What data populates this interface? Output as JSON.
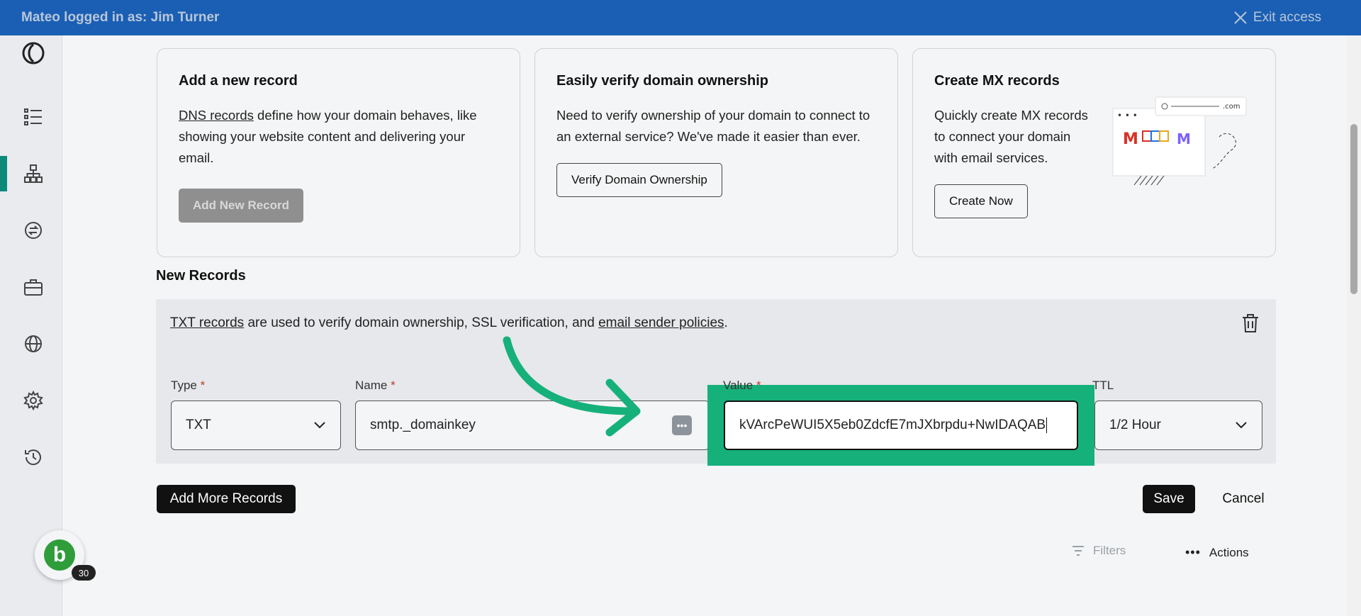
{
  "topbar": {
    "logged_in_text": "Mateo logged in as: Jim Turner",
    "exit_label": "Exit access"
  },
  "sidebar": {
    "icons": [
      "logo-icon",
      "list-icon",
      "sitemap-icon",
      "transfer-icon",
      "briefcase-icon",
      "globe-icon",
      "gear-icon",
      "history-icon"
    ],
    "avatar_letter": "b",
    "avatar_badge": "30"
  },
  "cards": [
    {
      "title": "Add a new record",
      "link_text": "DNS records",
      "body": " define how your domain behaves, like showing your website content and delivering your email.",
      "button": "Add New Record"
    },
    {
      "title": "Easily verify domain ownership",
      "body": "Need to verify ownership of your domain to connect to an external service? We've made it easier than ever.",
      "button": "Verify Domain Ownership"
    },
    {
      "title": "Create MX records",
      "body": "Quickly create MX records to connect your domain with email services.",
      "button": "Create Now",
      "illustration_text": ".com"
    }
  ],
  "new_records": {
    "title": "New Records",
    "info_link1": "TXT records",
    "info_mid": " are used to verify domain ownership, SSL verification, and ",
    "info_link2": "email sender policies",
    "info_end": ".",
    "type_label": "Type",
    "type_value": "TXT",
    "name_label": "Name",
    "name_value": "smtp._domainkey",
    "value_label": "Value",
    "value_value": "kVArcPeWUI5X5eb0ZdcfE7mJXbrpdu+NwIDAQAB",
    "ttl_label": "TTL",
    "ttl_value": "1/2 Hour",
    "required_mark": "*"
  },
  "buttons": {
    "add_more": "Add More Records",
    "save": "Save",
    "cancel": "Cancel",
    "filters": "Filters",
    "actions": "Actions"
  },
  "colors": {
    "topbar": "#1a5fb4",
    "highlight": "#16b17b",
    "active_nav": "#0b8a7a"
  }
}
